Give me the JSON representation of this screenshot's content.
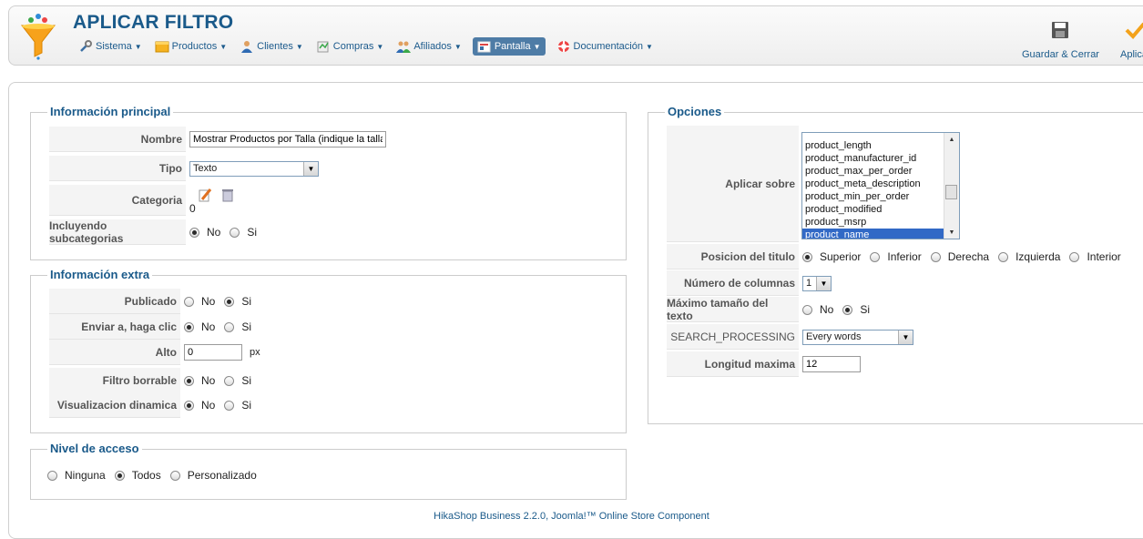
{
  "header": {
    "title": "APLICAR FILTRO",
    "menu": [
      {
        "label": "Sistema",
        "icon": "wrench-icon"
      },
      {
        "label": "Productos",
        "icon": "box-icon"
      },
      {
        "label": "Clientes",
        "icon": "user-icon"
      },
      {
        "label": "Compras",
        "icon": "cart-icon"
      },
      {
        "label": "Afiliados",
        "icon": "people-icon"
      },
      {
        "label": "Pantalla",
        "icon": "monitor-icon",
        "active": true
      },
      {
        "label": "Documentación",
        "icon": "lifebuoy-icon"
      }
    ],
    "toolbar": {
      "save_close_label": "Guardar & Cerrar",
      "apply_label": "Aplicar"
    }
  },
  "info_principal": {
    "legend": "Información principal",
    "nombre_label": "Nombre",
    "nombre_value": "Mostrar Productos por Talla (indique la talla e",
    "tipo_label": "Tipo",
    "tipo_value": "Texto",
    "categoria_label": "Categoria",
    "categoria_value": "0",
    "subcat_label": "Incluyendo subcategorias",
    "no_label": "No",
    "si_label": "Si"
  },
  "info_extra": {
    "legend": "Información extra",
    "publicado_label": "Publicado",
    "enviar_label": "Enviar a, haga clic",
    "alto_label": "Alto",
    "alto_value": "0",
    "alto_unit": "px",
    "borrable_label": "Filtro borrable",
    "dinamica_label": "Visualizacion dinamica",
    "no_label": "No",
    "si_label": "Si"
  },
  "nivel_acceso": {
    "legend": "Nivel de acceso",
    "ninguna": "Ninguna",
    "todos": "Todos",
    "personalizado": "Personalizado"
  },
  "opciones": {
    "legend": "Opciones",
    "aplicar_label": "Aplicar sobre",
    "aplicar_list": [
      "product_length",
      "product_manufacturer_id",
      "product_max_per_order",
      "product_meta_description",
      "product_min_per_order",
      "product_modified",
      "product_msrp",
      "product_name"
    ],
    "posicion_label": "Posicion del titulo",
    "posicion_options": [
      "Superior",
      "Inferior",
      "Derecha",
      "Izquierda",
      "Interior"
    ],
    "columnas_label": "Número de columnas",
    "columnas_value": "1",
    "maximo_label": "Máximo tamaño del texto",
    "no_label": "No",
    "si_label": "Si",
    "search_label": "SEARCH_PROCESSING",
    "search_value": "Every words",
    "longitud_label": "Longitud maxima",
    "longitud_value": "12"
  },
  "footer": "HikaShop Business 2.2.0, Joomla!™ Online Store Component"
}
